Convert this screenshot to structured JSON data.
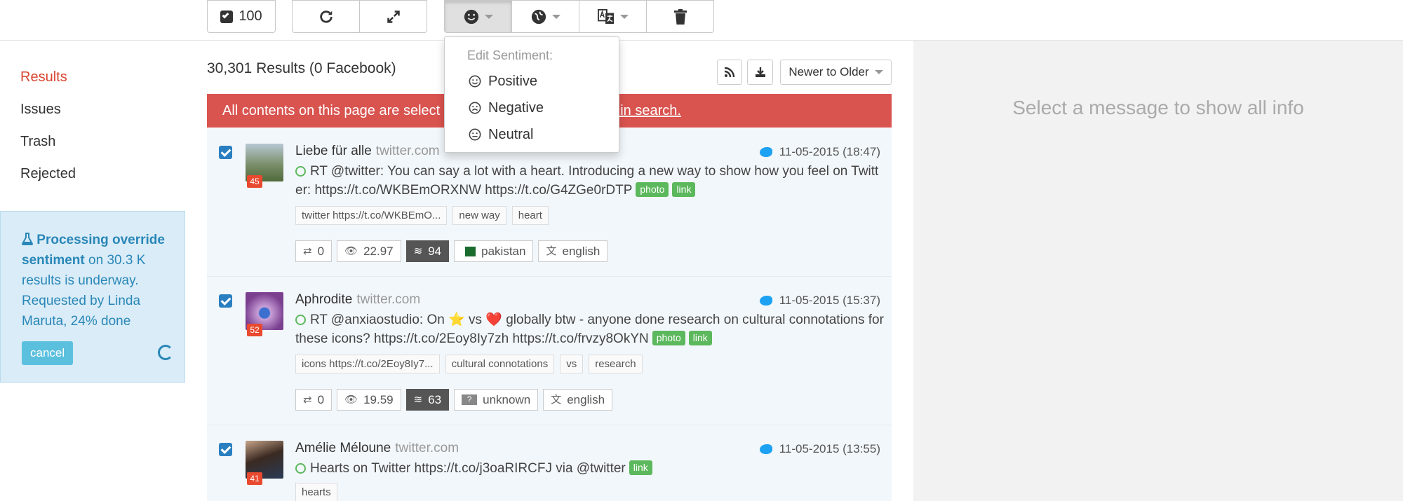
{
  "toolbar": {
    "select_count": "100",
    "icons": [
      "checkbox-icon",
      "refresh-icon",
      "expand-icon",
      "smile-icon",
      "globe-icon",
      "translate-icon",
      "trash-icon"
    ]
  },
  "sentiment_menu": {
    "header": "Edit Sentiment:",
    "items": [
      "Positive",
      "Negative",
      "Neutral"
    ]
  },
  "sidebar": {
    "items": [
      "Results",
      "Issues",
      "Trash",
      "Rejected"
    ],
    "active": "Results"
  },
  "processing": {
    "bold": "Processing override sentiment",
    "rest": " on 30.3 K results is underway. Requested by Linda Maruta, 24% done",
    "progress_percent": 24,
    "cancel_label": "cancel"
  },
  "results": {
    "count_label": "30,301 Results (0 Facebook)",
    "sort_label": "Newer to Older",
    "alert_text": "All contents on this page are select",
    "alert_link": "nts in search."
  },
  "items": [
    {
      "author": "Liebe für alle",
      "source": "twitter.com",
      "date": "11-05-2015 (18:47)",
      "score": "45",
      "text": "RT @twitter: You can say a lot with a heart. Introducing a new way to show how you feel on Twitter: https://t.co/WKBEmORXNW https://t.co/G4ZGe0rDTP",
      "badges": [
        "photo",
        "link"
      ],
      "tags": [
        "twitter https://t.co/WKBEmO...",
        "new way",
        "heart"
      ],
      "retweets": "0",
      "views": "22.97",
      "reach": "94",
      "country": "pakistan",
      "language": "english"
    },
    {
      "author": "Aphrodite",
      "source": "twitter.com",
      "date": "11-05-2015 (15:37)",
      "score": "52",
      "text": "RT @anxiaostudio: On ⭐ vs ❤️ globally btw - anyone done research on cultural connotations for these icons? https://t.co/2Eoy8Iy7zh https://t.co/frvzy8OkYN",
      "badges": [
        "photo",
        "link"
      ],
      "tags": [
        "icons https://t.co/2Eoy8Iy7...",
        "cultural connotations",
        "vs",
        "research"
      ],
      "retweets": "0",
      "views": "19.59",
      "reach": "63",
      "country": "unknown",
      "language": "english"
    },
    {
      "author": "Amélie Méloune",
      "source": "twitter.com",
      "date": "11-05-2015 (13:55)",
      "score": "41",
      "text": "Hearts on Twitter https://t.co/j3oaRIRCFJ via @twitter",
      "badges": [
        "link"
      ],
      "tags": [
        "hearts"
      ]
    }
  ],
  "detail": {
    "hint": "Select a message to show all info"
  },
  "colors": {
    "accent_red": "#d9452f",
    "alert_red": "#d9534f",
    "info_blue": "#2a87b8",
    "badge_green": "#5cb85c",
    "checkbox_blue": "#2a7fc1"
  }
}
